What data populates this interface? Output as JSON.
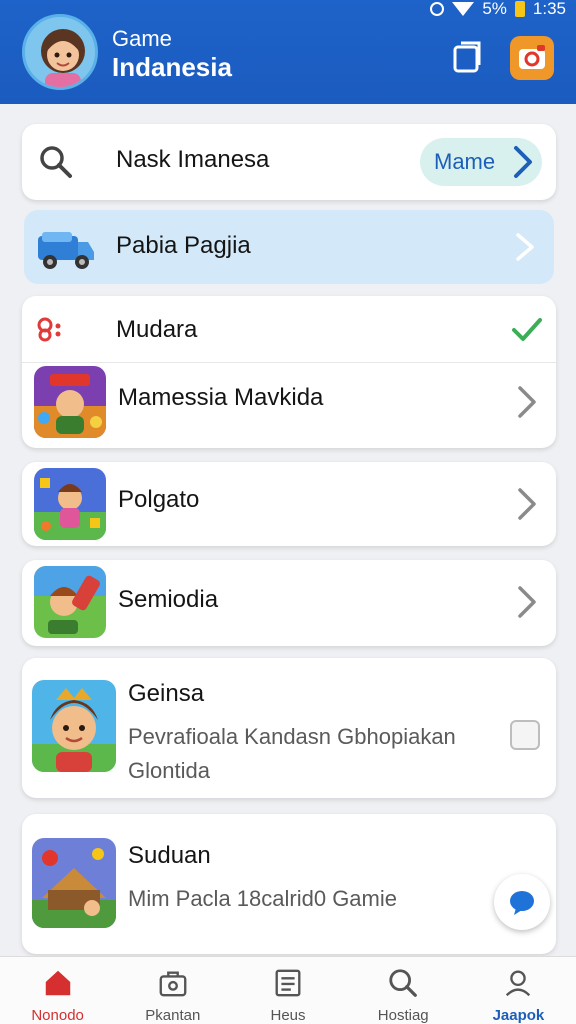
{
  "status_bar": {
    "battery": "5%",
    "time": "1:35"
  },
  "header": {
    "title_line1": "Game",
    "title_line2": "Indanesia"
  },
  "search": {
    "label": "Nask Imanesa",
    "button_label": "Mame"
  },
  "highlight": {
    "label": "Pabia Pagjia"
  },
  "group": {
    "top_label": "Mudara",
    "item_label": "Mamessia Mavkida"
  },
  "items": [
    {
      "label": "Polgato"
    },
    {
      "label": "Semiodia"
    }
  ],
  "detail_cards": [
    {
      "title": "Geinsa",
      "line1": "Pevrafioala Kandasn Gbhopiakan",
      "line2": "Glontida"
    },
    {
      "title": "Suduan",
      "line1": "Mim Pacla 18calrid0 Gamie"
    }
  ],
  "bottom_nav": [
    {
      "label": "Nonodo"
    },
    {
      "label": "Pkantan"
    },
    {
      "label": "Heus"
    },
    {
      "label": "Hostiag"
    },
    {
      "label": "Jaapok"
    }
  ],
  "colors": {
    "header_blue": "#1e63c9",
    "accent_blue": "#1d5fb8",
    "active_red": "#d62f2f",
    "check_green": "#3cae57"
  }
}
